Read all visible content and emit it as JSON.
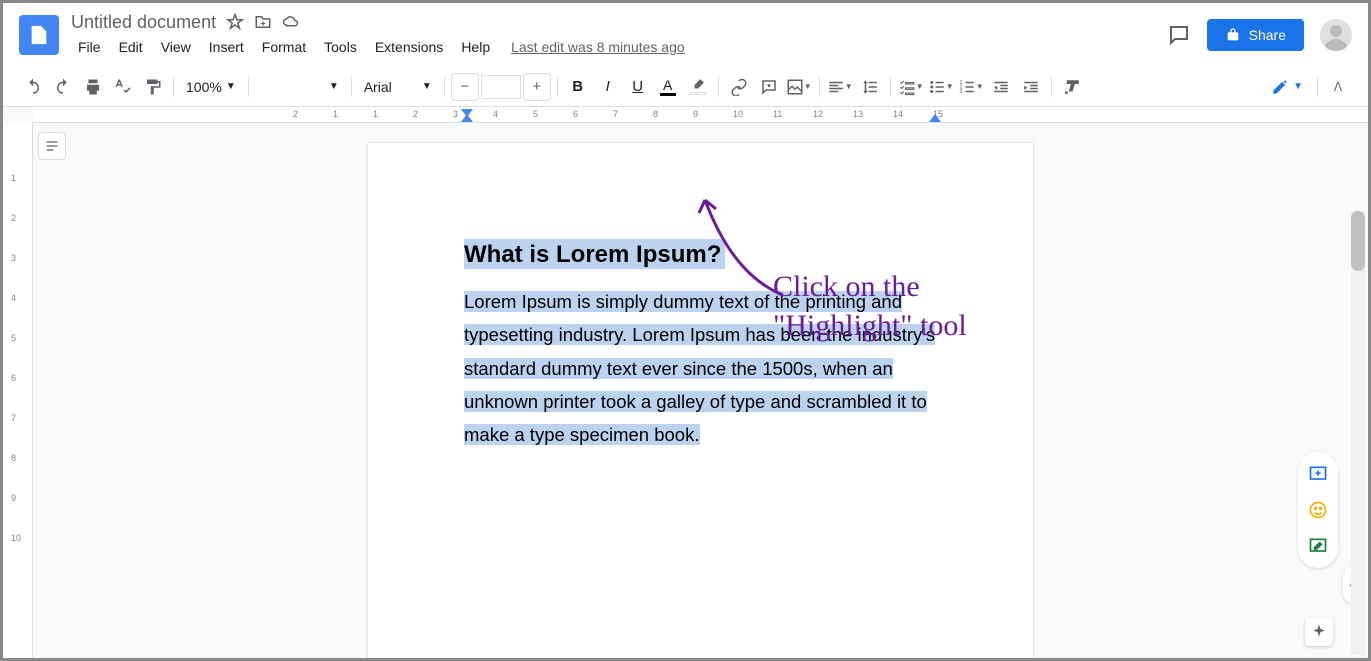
{
  "header": {
    "doc_title": "Untitled document",
    "last_edit": "Last edit was 8 minutes ago",
    "share_label": "Share"
  },
  "menu": {
    "file": "File",
    "edit": "Edit",
    "view": "View",
    "insert": "Insert",
    "format": "Format",
    "tools": "Tools",
    "extensions": "Extensions",
    "help": "Help"
  },
  "toolbar": {
    "zoom": "100%",
    "style_select": "",
    "font": "Arial",
    "font_size": ""
  },
  "hruler_nums": [
    "2",
    "1",
    "1",
    "2",
    "3",
    "4",
    "5",
    "6",
    "7",
    "8",
    "9",
    "10",
    "11",
    "12",
    "13",
    "14",
    "15"
  ],
  "vruler_nums": [
    "1",
    "2",
    "3",
    "4",
    "5",
    "6",
    "7",
    "8",
    "9",
    "10"
  ],
  "document": {
    "heading": "What is Lorem Ipsum?",
    "body": "Lorem Ipsum is simply dummy text of the printing and typesetting industry. Lorem Ipsum has been the industry's standard dummy text ever since the 1500s, when an unknown printer took a galley of type and scrambled it to make a type specimen book."
  },
  "annotation": {
    "line1": "Click on the",
    "line2": "\"Highlight\" tool"
  }
}
